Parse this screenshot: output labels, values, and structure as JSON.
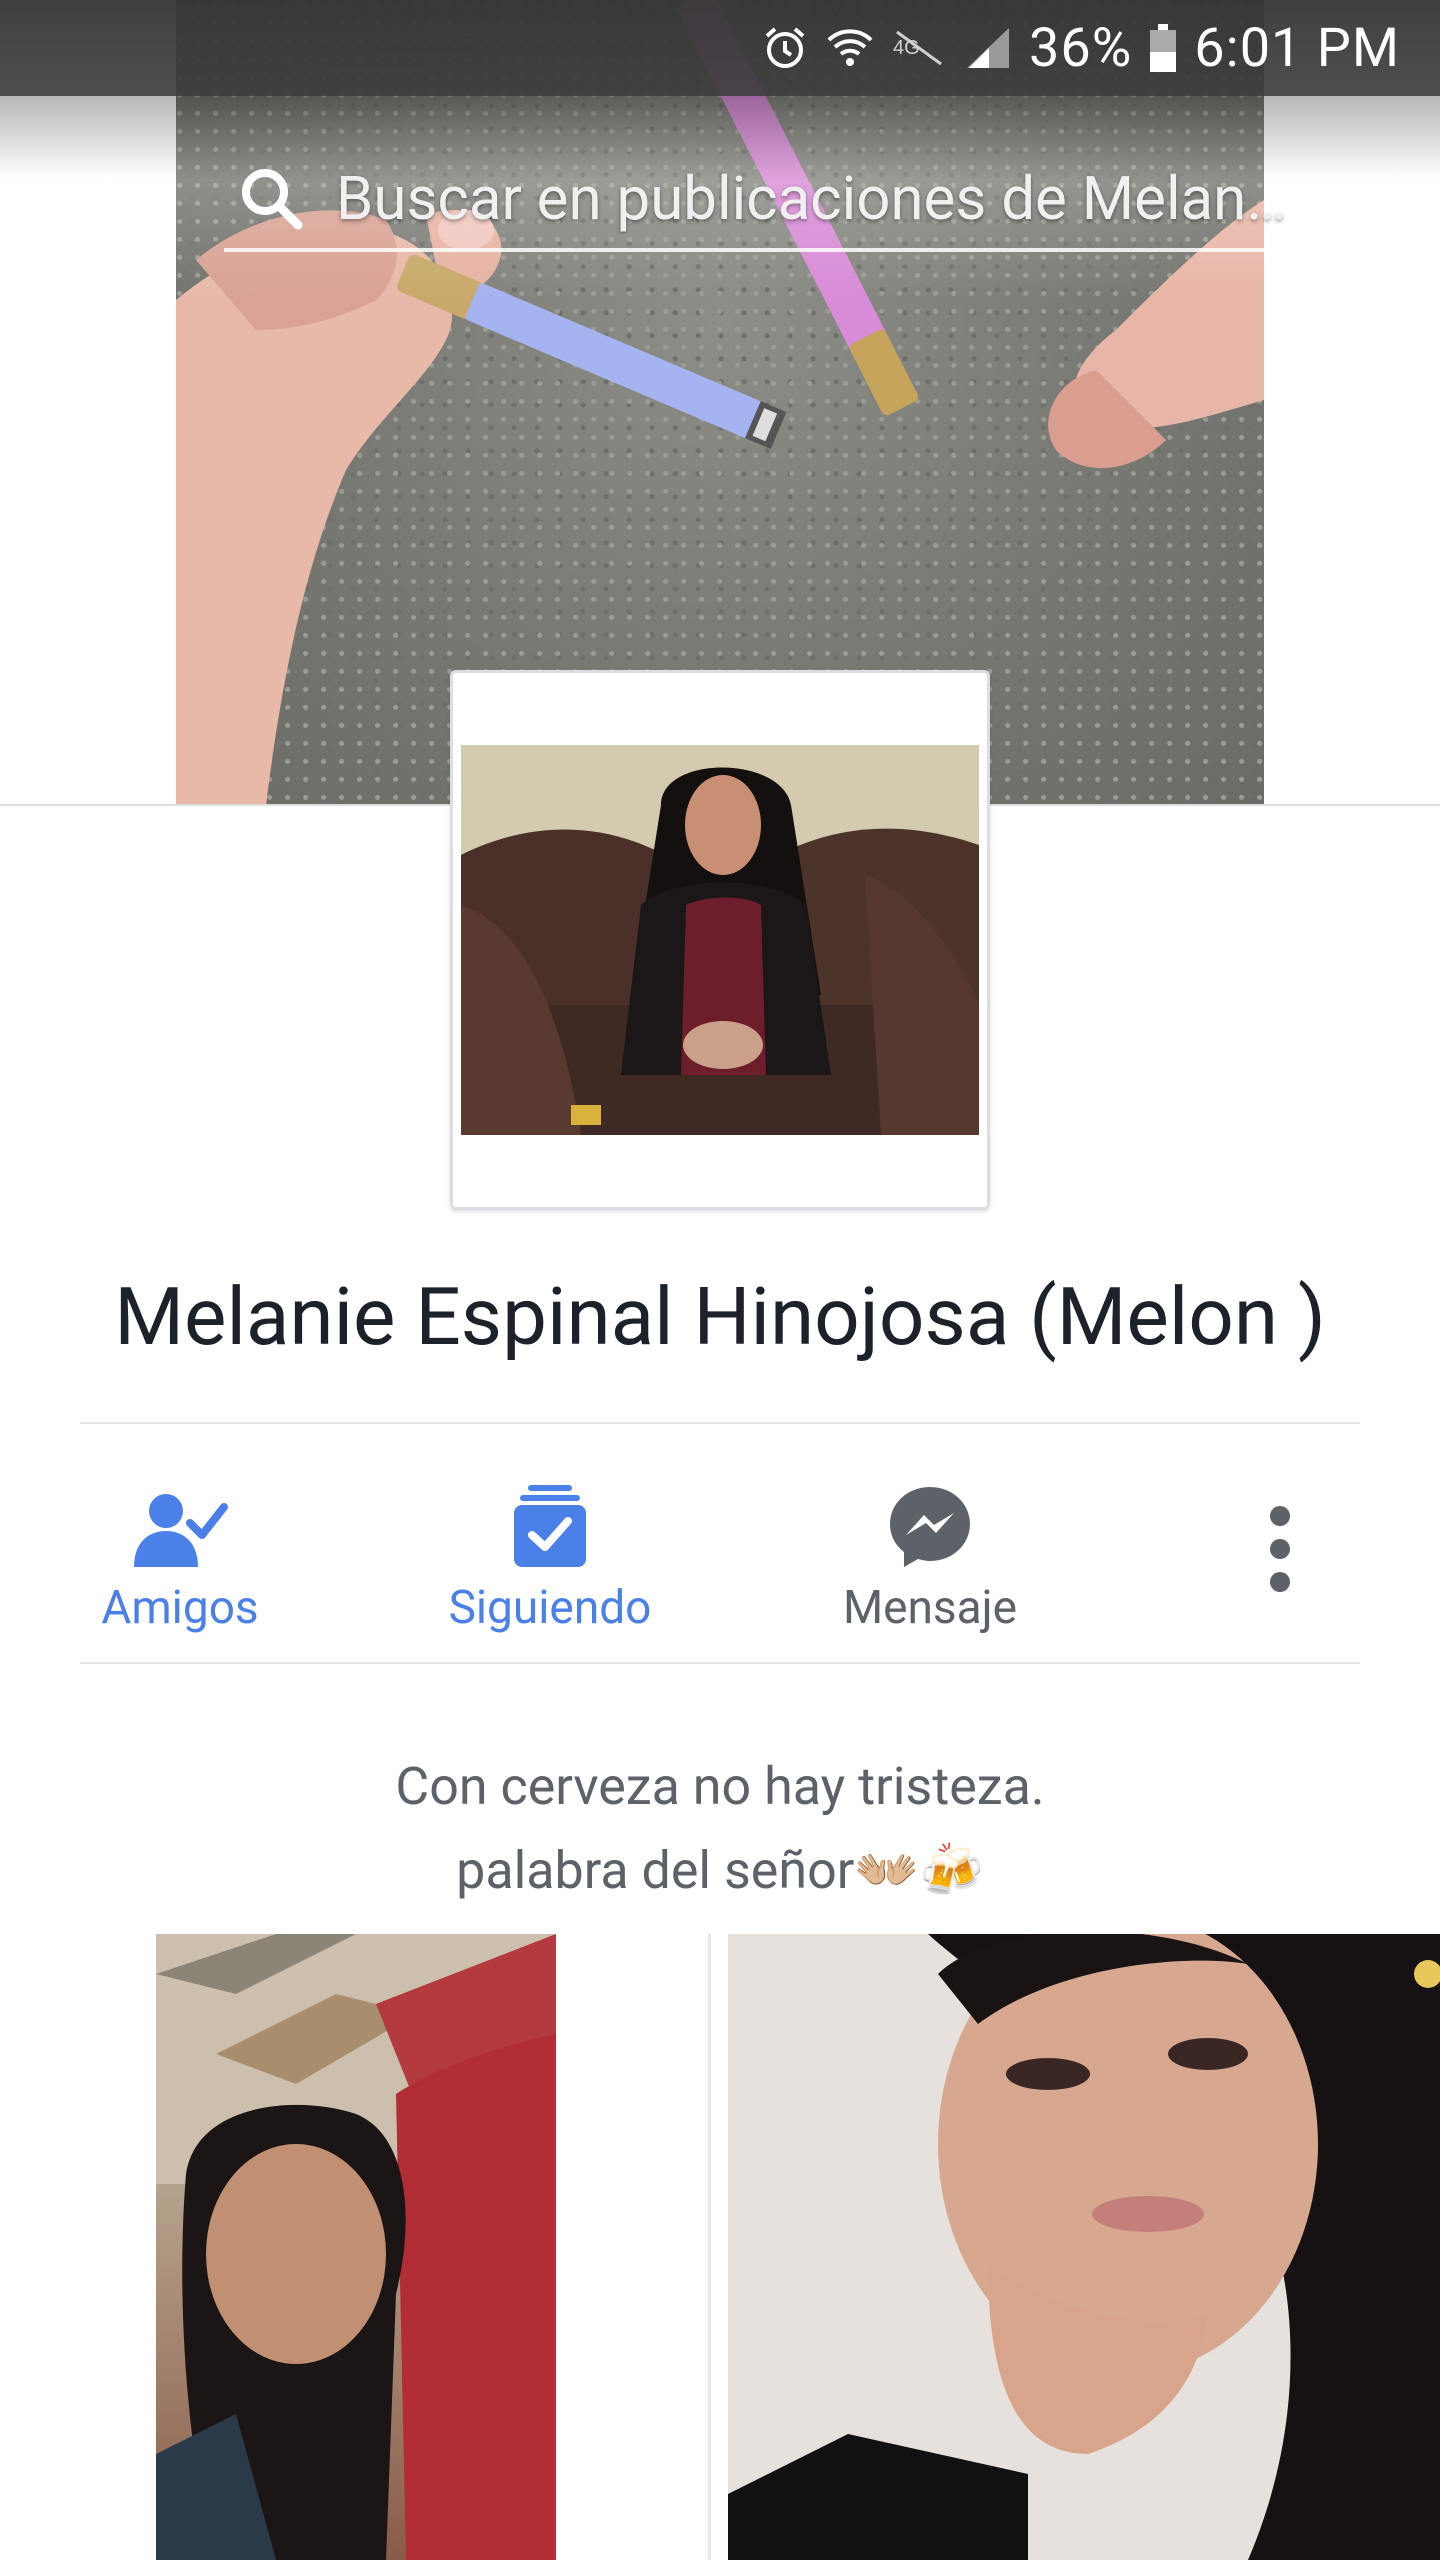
{
  "status_bar": {
    "battery": "36%",
    "time": "6:01 PM",
    "icons": [
      "alarm-icon",
      "wifi-icon",
      "data-off-icon",
      "signal-icon",
      "battery-icon"
    ]
  },
  "header": {
    "back_icon": "arrow-left-icon",
    "search_icon": "search-icon",
    "search_placeholder": "Buscar en publicaciones de Melan…"
  },
  "profile": {
    "name": "Melanie Espinal Hinojosa (Melon )",
    "bio_line_1": "Con cerveza no hay tristeza.",
    "bio_line_2": "palabra del señor👐🏼🍻"
  },
  "actions": [
    {
      "label": "Amigos",
      "icon": "friends-check-icon",
      "color": "#4a80e8"
    },
    {
      "label": "Siguiendo",
      "icon": "following-check-icon",
      "color": "#4a80e8"
    },
    {
      "label": "Mensaje",
      "icon": "messenger-icon",
      "color": "#5d6168"
    },
    {
      "label": "",
      "icon": "more-vertical-icon",
      "color": "#5d6168"
    }
  ],
  "colors": {
    "accent": "#4a80e8",
    "text_primary": "#1d2129",
    "text_secondary": "#5d6168",
    "divider": "#e5e6ea"
  }
}
